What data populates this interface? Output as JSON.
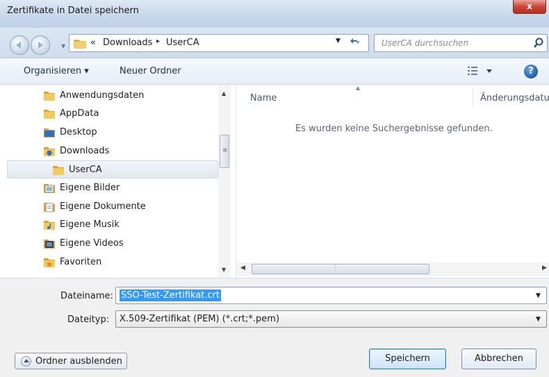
{
  "window": {
    "title": "Zertifikate in Datei speichern",
    "close_label": "x"
  },
  "address": {
    "prefix": "«",
    "crumbs": [
      "Downloads",
      "UserCA"
    ],
    "separator": "▸"
  },
  "search": {
    "placeholder": "UserCA durchsuchen"
  },
  "toolbar": {
    "organize_label": "Organisieren ▾",
    "new_folder_label": "Neuer Ordner"
  },
  "nav": {
    "items": [
      {
        "label": "Anwendungsdaten",
        "icon": "folder-icon"
      },
      {
        "label": "AppData",
        "icon": "folder-icon"
      },
      {
        "label": "Desktop",
        "icon": "desktop-folder-icon"
      },
      {
        "label": "Downloads",
        "icon": "downloads-folder-icon"
      },
      {
        "label": "UserCA",
        "icon": "folder-icon",
        "selected": true
      },
      {
        "label": "Eigene Bilder",
        "icon": "pictures-folder-icon"
      },
      {
        "label": "Eigene Dokumente",
        "icon": "documents-folder-icon"
      },
      {
        "label": "Eigene Musik",
        "icon": "music-folder-icon"
      },
      {
        "label": "Eigene Videos",
        "icon": "videos-folder-icon"
      },
      {
        "label": "Favoriten",
        "icon": "favorites-folder-icon"
      }
    ]
  },
  "file_list": {
    "columns": [
      "Name",
      "Änderungsdatu"
    ],
    "empty_message": "Es wurden keine Suchergebnisse gefunden."
  },
  "form": {
    "filename_label": "Dateiname:",
    "filename_value": "SSO-Test-Zertifikat.crt",
    "filetype_label": "Dateityp:",
    "filetype_value": "X.509-Zertifikat (PEM) (*.crt;*.pem)"
  },
  "buttons": {
    "hide_folders": "Ordner ausblenden",
    "save": "Speichern",
    "cancel": "Abbrechen"
  },
  "colors": {
    "selection": "#3399ff",
    "folder": "#e8b84a",
    "accent": "#2b6fb6"
  }
}
